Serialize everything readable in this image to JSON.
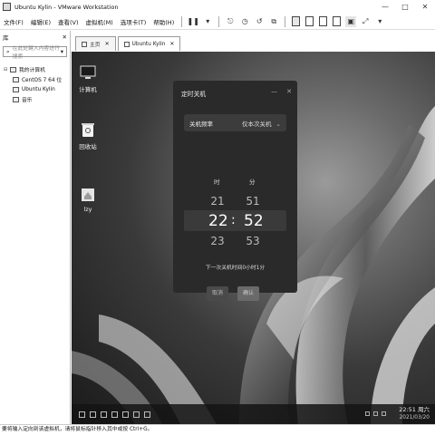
{
  "window": {
    "title": "Ubuntu Kylin - VMware Workstation",
    "controls": [
      "—",
      "□",
      "✕"
    ]
  },
  "menubar": {
    "items": [
      "文件(F)",
      "编辑(E)",
      "查看(V)",
      "虚拟机(M)",
      "选项卡(T)",
      "帮助(H)"
    ]
  },
  "sidebar": {
    "title": "库",
    "close": "✕",
    "search_placeholder": "在此处键入内容进行搜索",
    "tree": [
      {
        "label": "我的计算机",
        "expander": "⊟"
      },
      {
        "label": "CentOS 7 64 位"
      },
      {
        "label": "Ubuntu Kylin"
      },
      {
        "label": "音乐"
      }
    ]
  },
  "tabs": [
    {
      "label": "主页",
      "close": "✕"
    },
    {
      "label": "Ubuntu Kylin",
      "close": "✕"
    }
  ],
  "desktop": {
    "icons": [
      {
        "label": "计算机",
        "icon": "computer-icon"
      },
      {
        "label": "回收站",
        "icon": "trash-icon"
      },
      {
        "label": "lzy",
        "icon": "home-folder-icon"
      }
    ]
  },
  "dialog": {
    "title": "定时关机",
    "min": "—",
    "close": "✕",
    "freq_label": "关机频率",
    "freq_value": "仅本次关机",
    "hour_header": "时",
    "minute_header": "分",
    "hours": {
      "prev": "21",
      "current": "22",
      "next": "23"
    },
    "minutes": {
      "prev": "51",
      "current": "52",
      "next": "53"
    },
    "colon": ":",
    "next_shutdown": "下一次关机时间0小时1分",
    "cancel": "取消",
    "confirm": "确认"
  },
  "taskbar": {
    "time": "22:51 周六",
    "date": "2021/03/20"
  },
  "statusbar": {
    "text": "要将输入定向到该虚拟机，请将鼠标指针移入其中或按 Ctrl+G。"
  }
}
